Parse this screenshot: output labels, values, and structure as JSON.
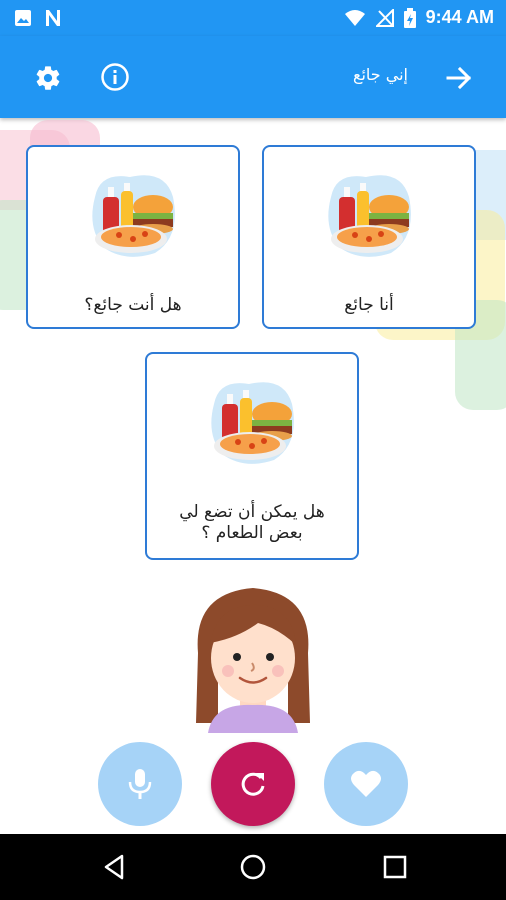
{
  "status_bar": {
    "time": "9:44 AM",
    "left_icons": [
      "image-icon",
      "n-icon"
    ],
    "right_icons": [
      "wifi-icon",
      "signal-off-icon",
      "battery-icon"
    ]
  },
  "app_bar": {
    "title": "إني جائع",
    "icons": [
      "gear-icon",
      "info-icon",
      "arrow-forward-icon"
    ]
  },
  "cards": [
    {
      "label": "أنا جائع",
      "icon": "food-icon"
    },
    {
      "label": "هل أنت جائع؟",
      "icon": "food-icon"
    },
    {
      "label": "هل يمكن أن تضع لي بعض الطعام ؟",
      "icon": "food-icon"
    }
  ],
  "avatar": {
    "icon": "girl-avatar-icon"
  },
  "actions": [
    {
      "name": "mic",
      "icon": "mic-icon",
      "color": "#a6d3f7"
    },
    {
      "name": "refresh",
      "icon": "refresh-icon",
      "color": "#c2185b"
    },
    {
      "name": "favorite",
      "icon": "heart-icon",
      "color": "#a6d3f7"
    }
  ],
  "nav_bar": {
    "icons": [
      "back-icon",
      "home-icon",
      "recents-icon"
    ]
  },
  "colors": {
    "primary": "#2196F3",
    "card_border": "#2e7bd6",
    "accent": "#c2185b"
  }
}
